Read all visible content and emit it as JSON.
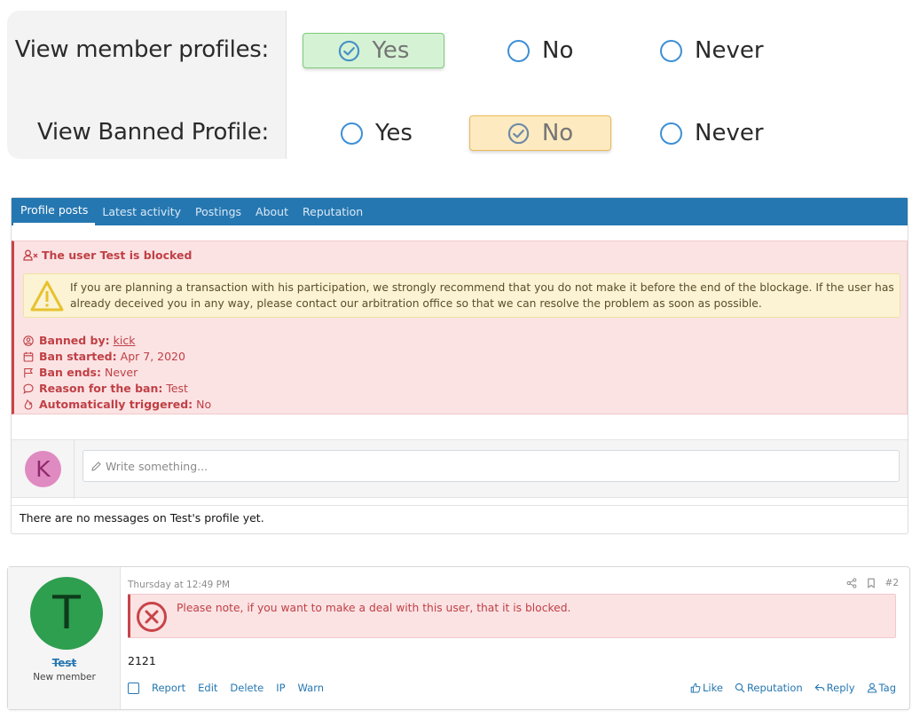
{
  "permissions": {
    "rows": [
      {
        "label": "View member profiles:",
        "options": [
          "Yes",
          "No",
          "Never"
        ],
        "selected": "Yes"
      },
      {
        "label": "View Banned Profile:",
        "options": [
          "Yes",
          "No",
          "Never"
        ],
        "selected": "No"
      }
    ],
    "colors": {
      "selected_green": "#d5f3d4",
      "selected_amber": "#fdeac0",
      "radio": "#3d8fd6"
    }
  },
  "profile": {
    "tabs": [
      "Profile posts",
      "Latest activity",
      "Postings",
      "About",
      "Reputation"
    ],
    "active_tab": "Profile posts",
    "ban": {
      "title": "The user Test is blocked",
      "warning": "If you are planning a transaction with his participation, we strongly recommend that you do not make it before the end of the blockage. If the user has already deceived you in any way, please contact our arbitration office so that we can resolve the problem as soon as possible.",
      "banned_by_label": "Banned by:",
      "banned_by_value": "kick",
      "started_label": "Ban started:",
      "started_value": "Apr 7, 2020",
      "ends_label": "Ban ends:",
      "ends_value": "Never",
      "reason_label": "Reason for the ban:",
      "reason_value": "Test",
      "auto_label": "Automatically triggered:",
      "auto_value": "No"
    },
    "composer": {
      "avatar_letter": "K",
      "placeholder": "Write something..."
    },
    "no_messages": "There are no messages on Test's profile yet."
  },
  "post": {
    "avatar_letter": "T",
    "username": "Test",
    "user_title": "New member",
    "time": "Thursday at 12:49 PM",
    "post_number": "#2",
    "notice": "Please note, if you want to make a deal with this user, that it is blocked.",
    "body": "2121",
    "actions_left": [
      "Report",
      "Edit",
      "Delete",
      "IP",
      "Warn"
    ],
    "actions_right": {
      "like": "Like",
      "reputation": "Reputation",
      "reply": "Reply",
      "tag": "Tag"
    }
  },
  "icons": [
    "check-circle-icon",
    "radio-empty-icon",
    "user-blocked-icon",
    "warning-triangle-icon",
    "user-circle-icon",
    "calendar-icon",
    "flag-icon",
    "comment-icon",
    "flame-icon",
    "pencil-icon",
    "share-icon",
    "bookmark-icon",
    "error-circle-icon",
    "thumbs-up-icon",
    "search-icon",
    "reply-icon",
    "user-tag-icon"
  ]
}
